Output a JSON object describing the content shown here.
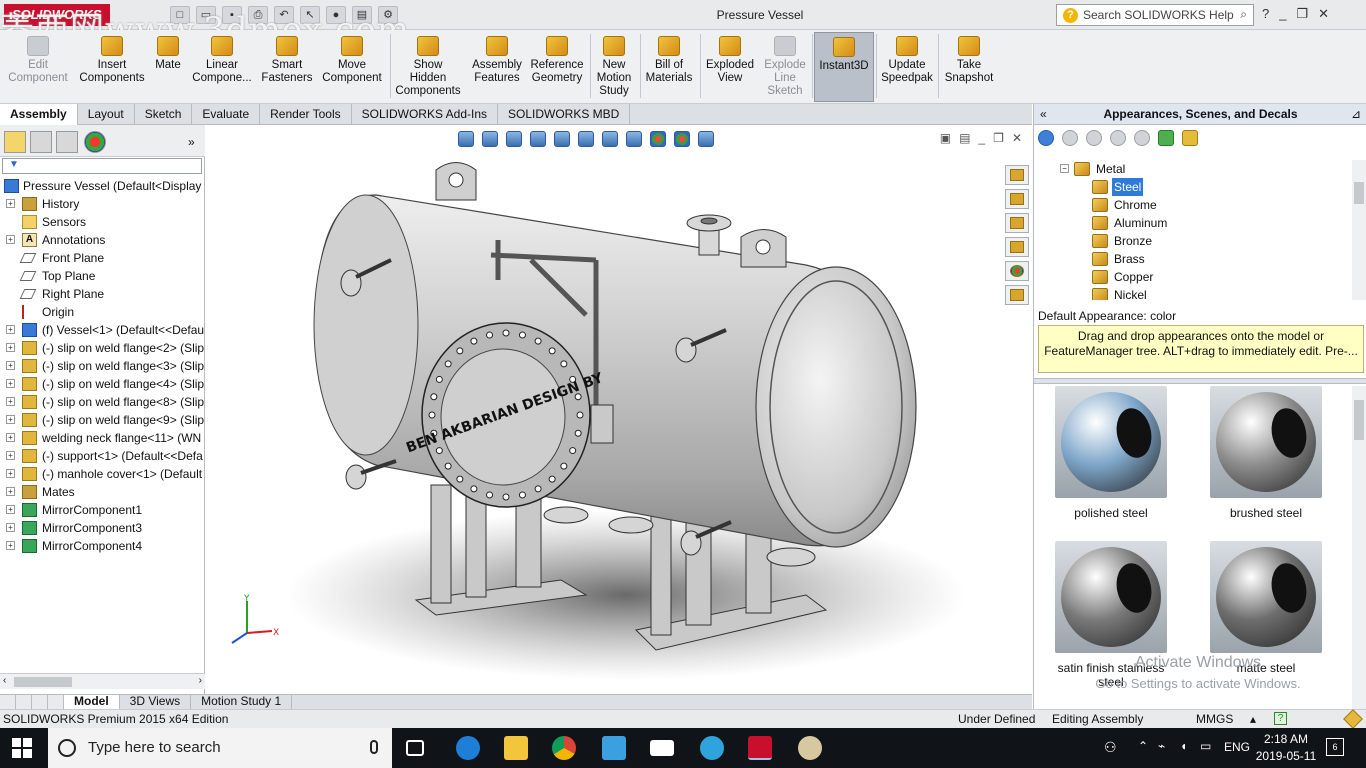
{
  "titlebar": {
    "logo": "SOLIDWORKS",
    "document_title": "Pressure Vessel",
    "help_search_placeholder": "Search SOLIDWORKS Help",
    "help_icon": "question-icon",
    "minimize": "_",
    "restore": "❐",
    "close": "✕"
  },
  "watermark": "菱西网www.3dmox.com",
  "ribbon": {
    "buttons": [
      {
        "label": "Edit\nComponent",
        "enabled": false
      },
      {
        "label": "Insert\nComponents",
        "enabled": true
      },
      {
        "label": "Mate",
        "enabled": true
      },
      {
        "label": "Linear\nCompone...",
        "enabled": true
      },
      {
        "label": "Smart\nFasteners",
        "enabled": true
      },
      {
        "label": "Move\nComponent",
        "enabled": true
      },
      {
        "label": "Show\nHidden\nComponents",
        "enabled": true
      },
      {
        "label": "Assembly\nFeatures",
        "enabled": true
      },
      {
        "label": "Reference\nGeometry",
        "enabled": true
      },
      {
        "label": "New\nMotion\nStudy",
        "enabled": true
      },
      {
        "label": "Bill of\nMaterials",
        "enabled": true
      },
      {
        "label": "Exploded\nView",
        "enabled": true
      },
      {
        "label": "Explode\nLine\nSketch",
        "enabled": false
      },
      {
        "label": "Instant3D",
        "enabled": true,
        "active": true
      },
      {
        "label": "Update\nSpeedpak",
        "enabled": true
      },
      {
        "label": "Take\nSnapshot",
        "enabled": true
      }
    ]
  },
  "command_tabs": [
    "Assembly",
    "Layout",
    "Sketch",
    "Evaluate",
    "Render Tools",
    "SOLIDWORKS Add-Ins",
    "SOLIDWORKS MBD"
  ],
  "feature_tree": {
    "root": "Pressure Vessel  (Default<Display S",
    "items": [
      {
        "label": "History",
        "icon": "fld",
        "exp": true
      },
      {
        "label": "Sensors",
        "icon": "sens",
        "exp": false
      },
      {
        "label": "Annotations",
        "icon": "ann",
        "exp": true
      },
      {
        "label": "Front Plane",
        "icon": "pln",
        "exp": false
      },
      {
        "label": "Top Plane",
        "icon": "pln",
        "exp": false
      },
      {
        "label": "Right Plane",
        "icon": "pln",
        "exp": false
      },
      {
        "label": "Origin",
        "icon": "org",
        "exp": false
      },
      {
        "label": "(f) Vessel<1> (Default<<Defau",
        "icon": "asm",
        "exp": true
      },
      {
        "label": "(-) slip on weld flange<2> (Slip",
        "icon": "prt",
        "exp": true
      },
      {
        "label": "(-) slip on weld flange<3> (Slip",
        "icon": "prt",
        "exp": true
      },
      {
        "label": "(-) slip on weld flange<4> (Slip",
        "icon": "prt",
        "exp": true
      },
      {
        "label": "(-) slip on weld flange<8> (Slip",
        "icon": "prt",
        "exp": true
      },
      {
        "label": "(-) slip on weld flange<9> (Slip",
        "icon": "prt",
        "exp": true
      },
      {
        "label": "welding neck flange<11> (WN",
        "icon": "prt",
        "exp": true
      },
      {
        "label": "(-) support<1> (Default<<Defa",
        "icon": "prt",
        "exp": true
      },
      {
        "label": "(-) manhole cover<1> (Default",
        "icon": "prt",
        "exp": true
      },
      {
        "label": "Mates",
        "icon": "fld",
        "exp": true
      },
      {
        "label": "MirrorComponent1",
        "icon": "mir",
        "exp": true
      },
      {
        "label": "MirrorComponent3",
        "icon": "mir",
        "exp": true
      },
      {
        "label": "MirrorComponent4",
        "icon": "mir",
        "exp": true
      }
    ]
  },
  "model_engraving": "BEN AKBARIAN DESIGN BY",
  "bottom_tabs": [
    "Model",
    "3D Views",
    "Motion Study 1"
  ],
  "right_pane": {
    "title": "Appearances, Scenes, and Decals",
    "tree": [
      {
        "label": "Metal",
        "indent": 0,
        "selected": false
      },
      {
        "label": "Steel",
        "indent": 1,
        "selected": true
      },
      {
        "label": "Chrome",
        "indent": 1,
        "selected": false
      },
      {
        "label": "Aluminum",
        "indent": 1,
        "selected": false
      },
      {
        "label": "Bronze",
        "indent": 1,
        "selected": false
      },
      {
        "label": "Brass",
        "indent": 1,
        "selected": false
      },
      {
        "label": "Copper",
        "indent": 1,
        "selected": false
      },
      {
        "label": "Nickel",
        "indent": 1,
        "selected": false
      }
    ],
    "info_label": "Default Appearance: color",
    "tip": "Drag and drop appearances onto the model or FeatureManager tree.  ALT+drag to immediately edit.  Pre-...",
    "swatches": [
      {
        "label": "polished steel",
        "color": "#7ea6c9",
        "hole": true
      },
      {
        "label": "brushed steel",
        "color": "#8e8e8e",
        "hole": true
      },
      {
        "label": "satin finish stainless steel",
        "color": "#7a7a7a",
        "hole": true
      },
      {
        "label": "matte steel",
        "color": "#6e6e6e",
        "hole": true
      }
    ]
  },
  "activate_windows": {
    "line1": "Activate Windows",
    "line2": "Go to Settings to activate Windows."
  },
  "statusbar": {
    "edition": "SOLIDWORKS Premium 2015 x64 Edition",
    "state": "Under Defined",
    "mode": "Editing Assembly",
    "units": "MMGS"
  },
  "taskbar": {
    "search_placeholder": "Type here to search",
    "lang": "ENG",
    "time": "2:18 AM",
    "date": "2019-05-11",
    "notifications": "6"
  }
}
